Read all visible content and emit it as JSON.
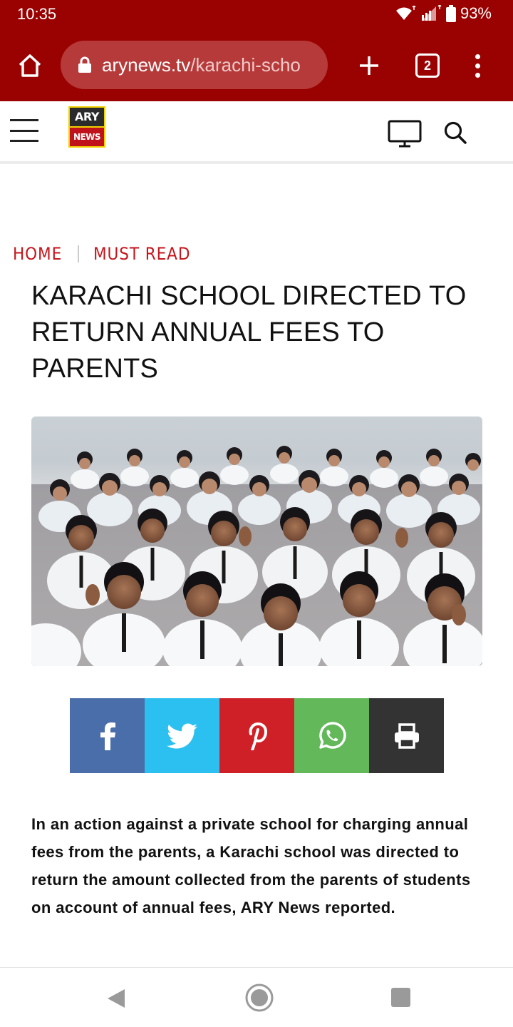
{
  "status_bar": {
    "time": "10:35",
    "battery": "93%"
  },
  "browser": {
    "url_domain": "arynews.tv",
    "url_path": "/karachi-scho",
    "tab_count": "2"
  },
  "site": {
    "logo_top": "ARY",
    "logo_bottom": "NEWS"
  },
  "breadcrumb": {
    "home": "HOME",
    "section": "MUST READ"
  },
  "article": {
    "headline": "KARACHI SCHOOL DIRECTED TO RETURN ANNUAL FEES TO PARENTS",
    "body": "In an action against a private school for charging annual fees from the parents, a Karachi school was directed to return the amount collected from the parents of students on account of annual fees, ARY News reported."
  },
  "share_buttons": [
    {
      "icon": "facebook-icon",
      "color": "#4a6ea9"
    },
    {
      "icon": "twitter-icon",
      "color": "#2cc0f0"
    },
    {
      "icon": "pinterest-icon",
      "color": "#cf2028"
    },
    {
      "icon": "whatsapp-icon",
      "color": "#63b95a"
    },
    {
      "icon": "print-icon",
      "color": "#333333"
    }
  ],
  "colors": {
    "browser_chrome": "#9a0101",
    "accent_red": "#c4161c"
  }
}
